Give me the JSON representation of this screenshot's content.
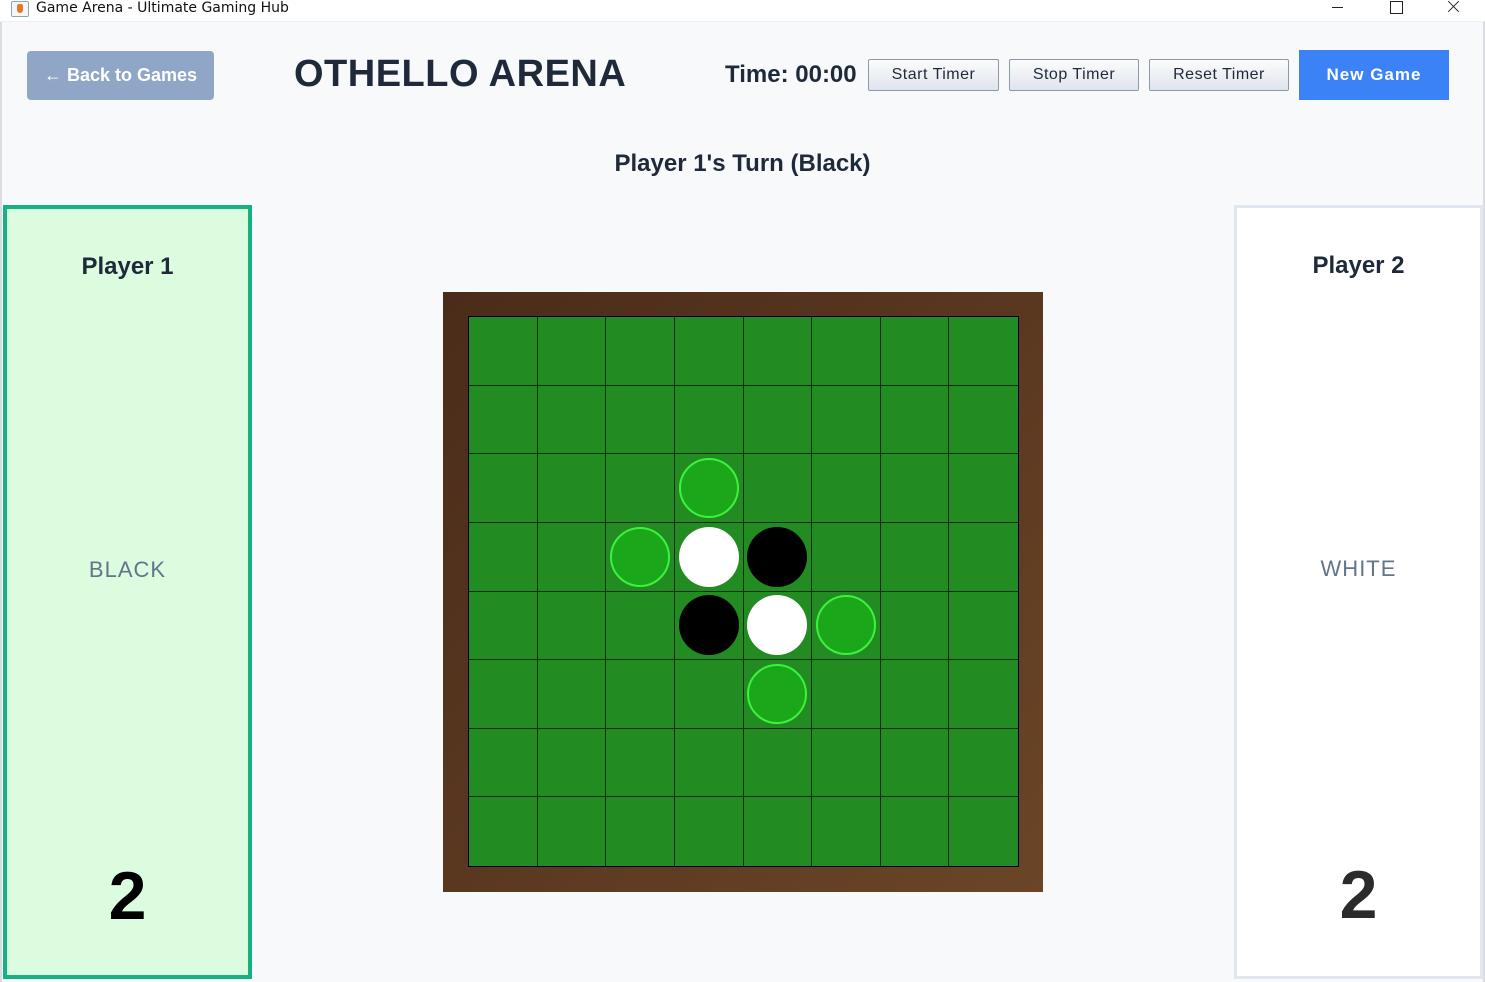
{
  "window": {
    "title": "Game Arena - Ultimate Gaming Hub"
  },
  "header": {
    "back_label": "← Back to Games",
    "title": "OTHELLO ARENA",
    "timer_text": "Time: 00:00",
    "start_timer_label": "Start Timer",
    "stop_timer_label": "Stop Timer",
    "reset_timer_label": "Reset Timer",
    "new_game_label": "New Game"
  },
  "turn": {
    "label": "Player 1's Turn (Black)"
  },
  "players": [
    {
      "name": "Player 1",
      "color_label": "BLACK",
      "score": "2",
      "active": true
    },
    {
      "name": "Player 2",
      "color_label": "WHITE",
      "score": "2",
      "active": false
    }
  ],
  "board": {
    "size": 8,
    "cells": [
      [
        "",
        "",
        "",
        "",
        "",
        "",
        "",
        ""
      ],
      [
        "",
        "",
        "",
        "",
        "",
        "",
        "",
        ""
      ],
      [
        "",
        "",
        "",
        "hint",
        "",
        "",
        "",
        ""
      ],
      [
        "",
        "",
        "hint",
        "white",
        "black",
        "",
        "",
        ""
      ],
      [
        "",
        "",
        "",
        "black",
        "white",
        "hint",
        "",
        ""
      ],
      [
        "",
        "",
        "",
        "",
        "hint",
        "",
        "",
        ""
      ],
      [
        "",
        "",
        "",
        "",
        "",
        "",
        "",
        ""
      ],
      [
        "",
        "",
        "",
        "",
        "",
        "",
        "",
        ""
      ]
    ]
  },
  "colors": {
    "board_green": "#228b22",
    "hint_green": "#1aa81a",
    "active_panel_border": "#16b085",
    "new_game_blue": "#3b82f6",
    "back_button": "#8fa6c7"
  }
}
